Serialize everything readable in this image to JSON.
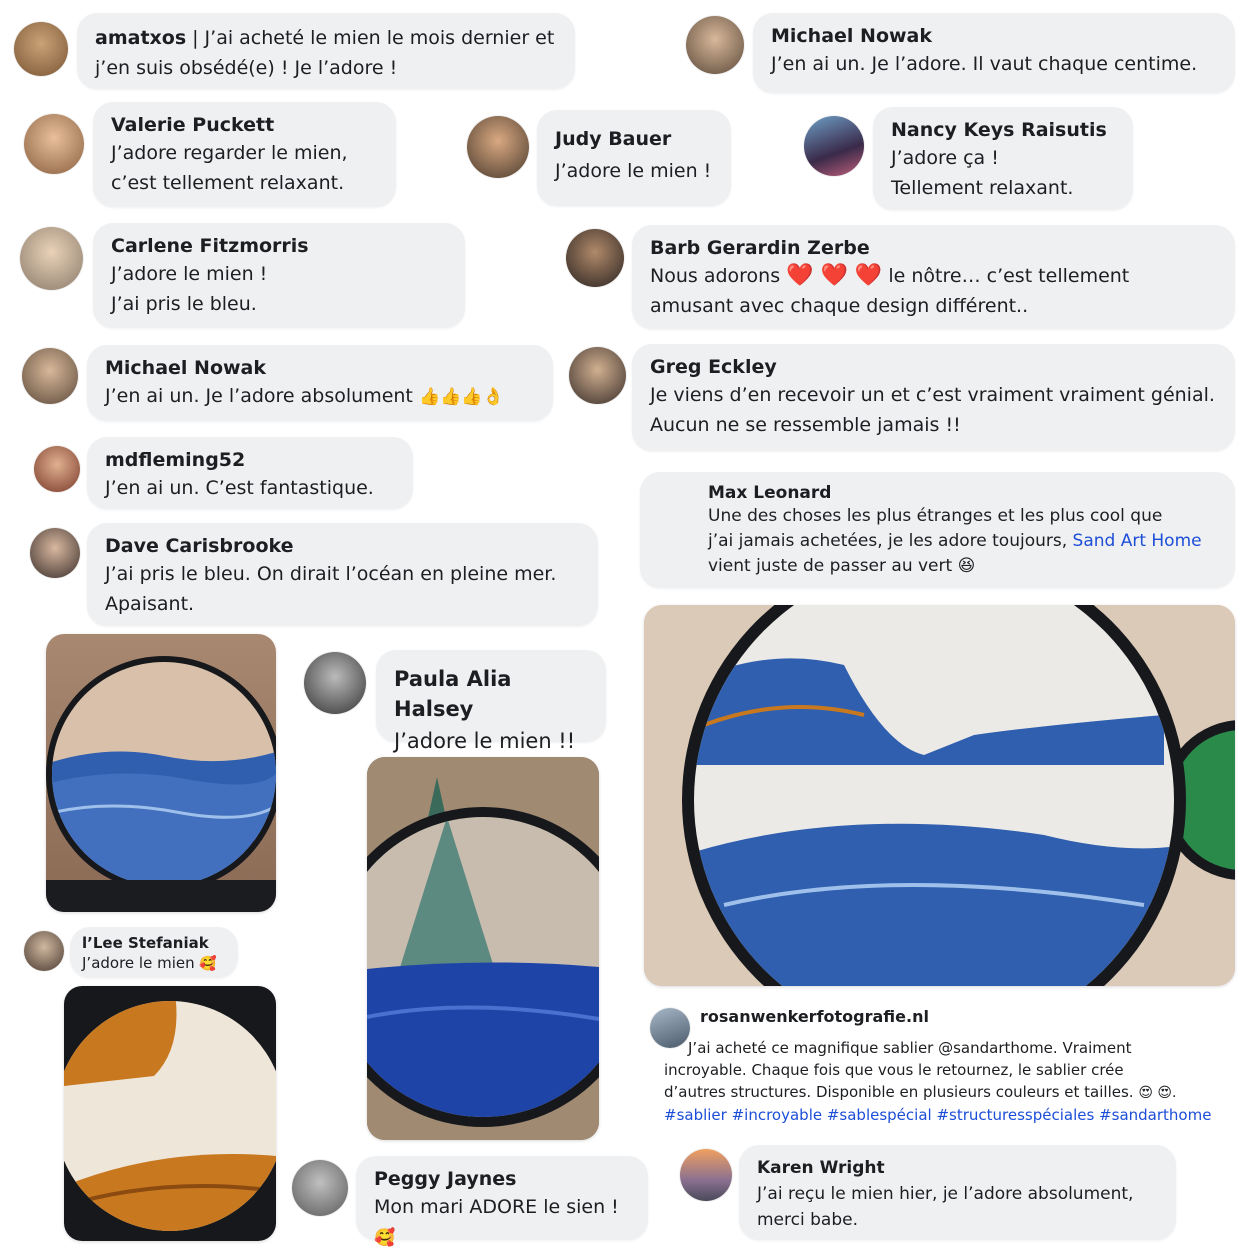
{
  "comments": [
    {
      "name": "amatxos",
      "text": "J’ai acheté le mien le mois dernier et j’en suis obsédé(e) ! Je l’adore !"
    },
    {
      "name": "Michael Nowak",
      "text": "J’en ai un. Je l’adore. Il vaut chaque centime."
    },
    {
      "name": "Valerie Puckett",
      "line1": "J’adore regarder le mien,",
      "line2": "c’est tellement relaxant."
    },
    {
      "name": "Judy Bauer",
      "text": "J’adore le mien !"
    },
    {
      "name": "Nancy Keys Raisutis",
      "line1": "J’adore ça !",
      "line2": "Tellement relaxant."
    },
    {
      "name": "Carlene Fitzmorris",
      "line1": "J’adore le mien !",
      "line2": "J’ai pris le bleu."
    },
    {
      "name": "Barb Gerardin Zerbe",
      "pre": "Nous adorons",
      "hearts": "❤️ ❤️ ❤️",
      "post": "le nôtre… c’est tellement",
      "line2": "amusant avec chaque design différent.."
    },
    {
      "name": "Michael Nowak",
      "text": "J’en ai un. Je l’adore absolument",
      "emoji": "👍👍👍👌"
    },
    {
      "name": "Greg Eckley",
      "line1": "Je viens d’en recevoir un et c’est vraiment vraiment génial.",
      "line2": "Aucun ne se ressemble jamais !!"
    },
    {
      "name": "mdfleming52",
      "text": "J’en ai un. C’est fantastique."
    },
    {
      "name": "Max Leonard",
      "line1": "Une des choses les plus étranges et les plus cool que",
      "line2pre": "j’ai jamais achetées, je les adore toujours,",
      "link": "Sand Art Home",
      "line3": "vient juste de passer au vert",
      "emoji": "😆"
    },
    {
      "name": "Dave Carisbrooke",
      "line1": "J’ai pris le bleu. On dirait l’océan en pleine mer.",
      "line2": "Apaisant."
    },
    {
      "name": "Paula Alia Halsey",
      "text": "J’adore le mien !!"
    },
    {
      "name": "l’Lee Stefaniak",
      "text": "J’adore le mien",
      "emoji": "🥰"
    },
    {
      "name": "rosanwenkerfotografie.nl",
      "line1": "J’ai acheté ce magnifique sablier @sandarthome. Vraiment",
      "line2": "incroyable. Chaque fois que vous le retournez, le sablier crée",
      "line3": "d’autres structures. Disponible en plusieurs couleurs et tailles.",
      "emoji": "😍 😍.",
      "hashtags": "#sablier #incroyable #sablespécial #structuresspéciales #sandarthome"
    },
    {
      "name": "Peggy Jaynes",
      "text": "Mon mari ADORE le sien !",
      "emoji": "🥰"
    },
    {
      "name": "Karen Wright",
      "line1": "J’ai reçu le mien hier, je l’adore absolument,",
      "line2": "merci babe."
    }
  ],
  "colors": {
    "bubble": "#eef0f2",
    "link": "#1d4ed8",
    "sand_blue": "#2f5fae",
    "sand_orange": "#c8781e",
    "frame": "#16181c"
  },
  "icons": [
    "avatar",
    "sand-art-photo"
  ]
}
